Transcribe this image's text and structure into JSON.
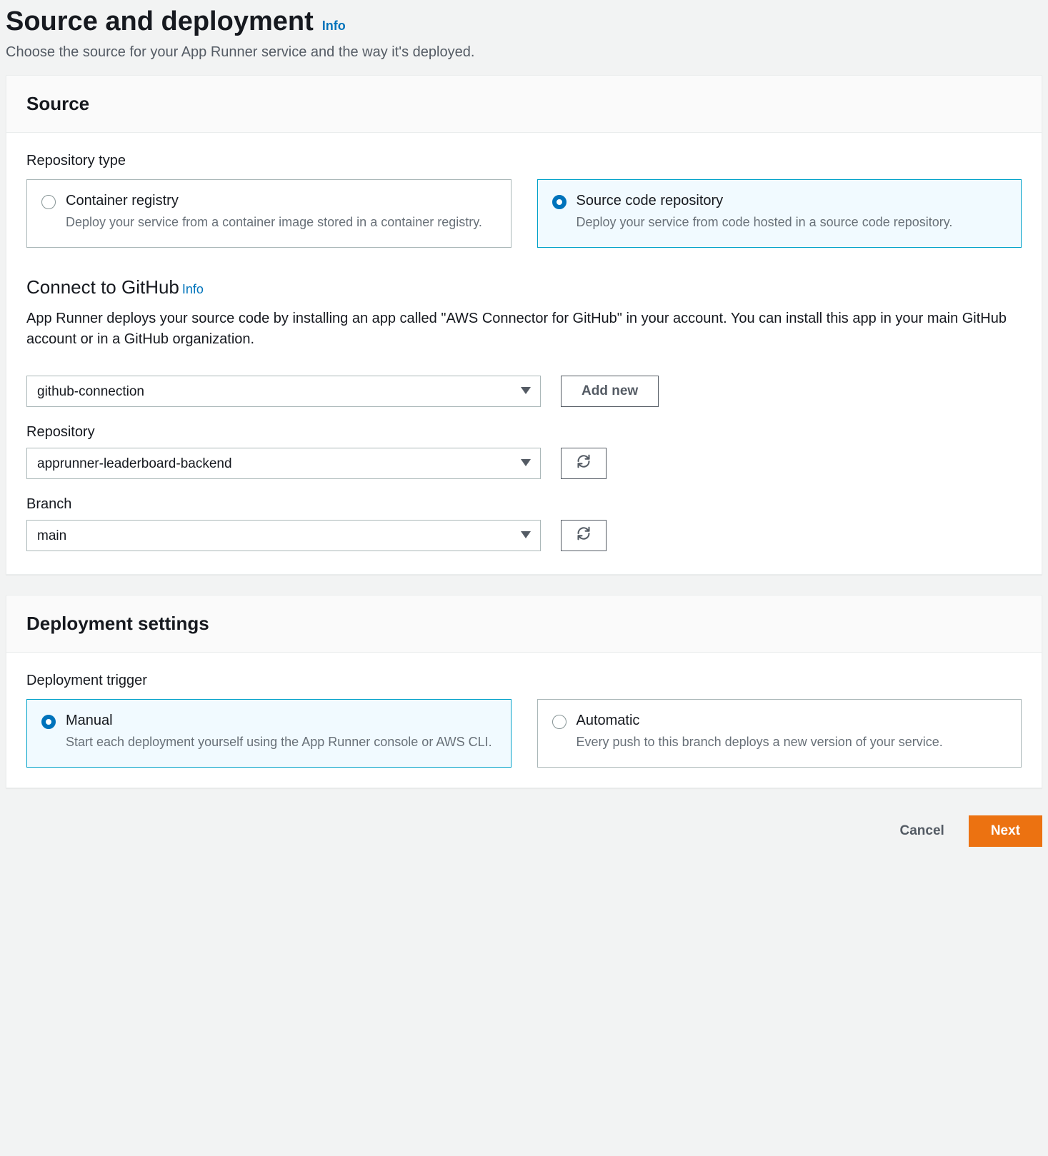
{
  "header": {
    "title": "Source and deployment",
    "info": "Info",
    "subtitle": "Choose the source for your App Runner service and the way it's deployed."
  },
  "source_panel": {
    "title": "Source",
    "repo_type_label": "Repository type",
    "options": [
      {
        "title": "Container registry",
        "desc": "Deploy your service from a container image stored in a container registry."
      },
      {
        "title": "Source code repository",
        "desc": "Deploy your service from code hosted in a source code repository."
      }
    ],
    "selected_option_index": 1,
    "connect": {
      "heading": "Connect to GitHub",
      "info": "Info",
      "desc": "App Runner deploys your source code by installing an app called \"AWS Connector for GitHub\" in your account. You can install this app in your main GitHub account or in a GitHub organization.",
      "connection_value": "github-connection",
      "add_new": "Add new",
      "repo_label": "Repository",
      "repo_value": "apprunner-leaderboard-backend",
      "branch_label": "Branch",
      "branch_value": "main"
    }
  },
  "deploy_panel": {
    "title": "Deployment settings",
    "trigger_label": "Deployment trigger",
    "options": [
      {
        "title": "Manual",
        "desc": "Start each deployment yourself using the App Runner console or AWS CLI."
      },
      {
        "title": "Automatic",
        "desc": "Every push to this branch deploys a new version of your service."
      }
    ],
    "selected_option_index": 0
  },
  "footer": {
    "cancel": "Cancel",
    "next": "Next"
  }
}
